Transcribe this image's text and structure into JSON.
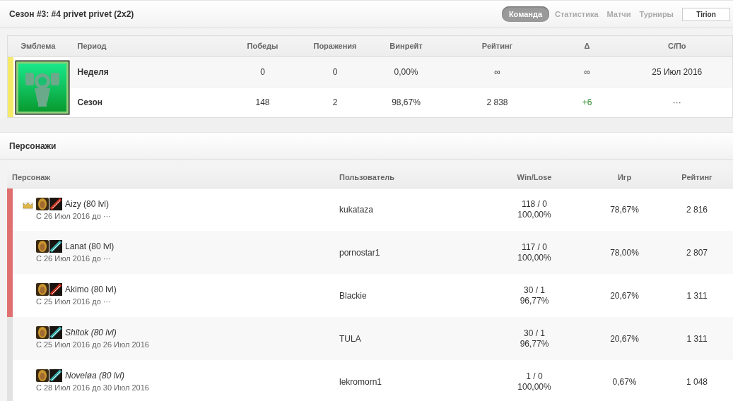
{
  "header": {
    "title": "Сезон #3: #4 privet privet (2x2)",
    "tabs": [
      {
        "label": "Команда",
        "selected": true
      },
      {
        "label": "Статистика",
        "selected": false
      },
      {
        "label": "Матчи",
        "selected": false
      },
      {
        "label": "Турниры",
        "selected": false
      }
    ],
    "realm": "Tirion"
  },
  "season_table": {
    "columns": [
      "Эмблема",
      "Период",
      "Победы",
      "Поражения",
      "Винрейт",
      "Рейтинг",
      "Δ",
      "С/По"
    ],
    "rows": [
      {
        "period": "Неделя",
        "wins": "0",
        "losses": "0",
        "winrate": "0,00%",
        "rating": "∞",
        "delta": "∞",
        "delta_positive": false,
        "dates": "25 Июл 2016"
      },
      {
        "period": "Сезон",
        "wins": "148",
        "losses": "2",
        "winrate": "98,67%",
        "rating": "2 838",
        "delta": "+6",
        "delta_positive": true,
        "dates": "···"
      }
    ]
  },
  "characters": {
    "title": "Персонажи",
    "columns": [
      "Персонаж",
      "Пользователь",
      "Win/Lose",
      "Игр",
      "Рейтинг"
    ],
    "rows": [
      {
        "name": "Aizy (80 lvl)",
        "period": "С 26 Июл 2016 до ···",
        "captain": true,
        "active": true,
        "kind": "fire",
        "user": "kukataza",
        "win_lose": "118 / 0",
        "win_pct": "100,00%",
        "played": "78,67%",
        "rating": "2 816"
      },
      {
        "name": "Lanat (80 lvl)",
        "period": "С 26 Июл 2016 до ···",
        "captain": false,
        "active": true,
        "kind": "frost",
        "user": "pornostar1",
        "win_lose": "117 / 0",
        "win_pct": "100,00%",
        "played": "78,00%",
        "rating": "2 807"
      },
      {
        "name": "Akimo (80 lvl)",
        "period": "С 25 Июл 2016 до ···",
        "captain": false,
        "active": true,
        "kind": "fire",
        "user": "Blackie",
        "win_lose": "30 / 1",
        "win_pct": "96,77%",
        "played": "20,67%",
        "rating": "1 311"
      },
      {
        "name": "Shitok (80 lvl)",
        "period": "С 25 Июл 2016 до 26 Июл 2016",
        "captain": false,
        "active": false,
        "kind": "frost",
        "user": "TULA",
        "win_lose": "30 / 1",
        "win_pct": "96,77%",
        "played": "20,67%",
        "rating": "1 311"
      },
      {
        "name": "Noveløa (80 lvl)",
        "period": "С 28 Июл 2016 до 30 Июл 2016",
        "captain": false,
        "active": false,
        "kind": "frost",
        "user": "lekromorn1",
        "win_lose": "1 / 0",
        "win_pct": "100,00%",
        "played": "0,67%",
        "rating": "1 048"
      }
    ]
  }
}
